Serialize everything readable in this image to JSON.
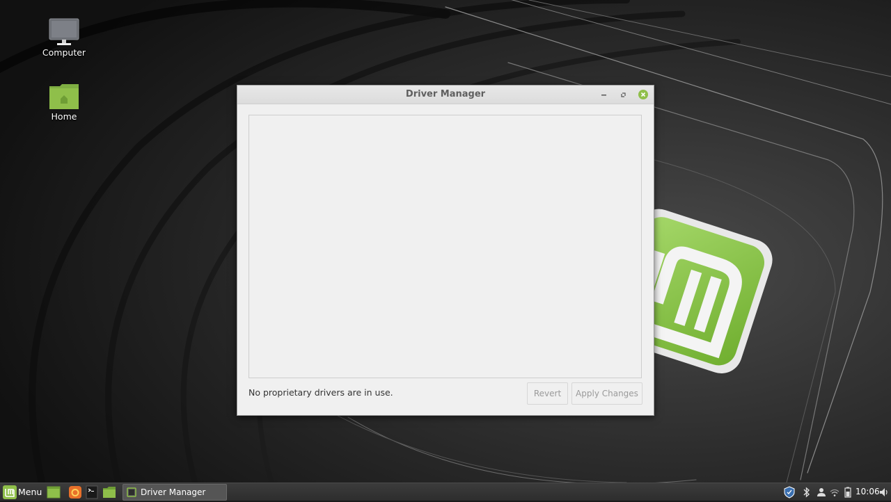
{
  "desktop": {
    "icons": [
      {
        "label": "Computer",
        "icon": "monitor-icon"
      },
      {
        "label": "Home",
        "icon": "home-folder-icon"
      }
    ],
    "accent_color": "#8fbf4a"
  },
  "window": {
    "title": "Driver Manager",
    "status_text": "No proprietary drivers are in use.",
    "buttons": {
      "revert": "Revert",
      "apply": "Apply Changes"
    },
    "controls": [
      "minimize-icon",
      "maximize-icon",
      "close-icon"
    ]
  },
  "taskbar": {
    "menu_label": "Menu",
    "launchers": [
      "show-desktop-icon",
      "firefox-icon",
      "terminal-icon",
      "files-icon"
    ],
    "tasks": [
      {
        "label": "Driver Manager",
        "icon": "driver-manager-icon"
      }
    ],
    "tray": [
      "shield-icon",
      "bluetooth-icon",
      "user-icon",
      "wifi-icon",
      "battery-icon",
      "volume-icon"
    ],
    "clock": "10:06"
  }
}
